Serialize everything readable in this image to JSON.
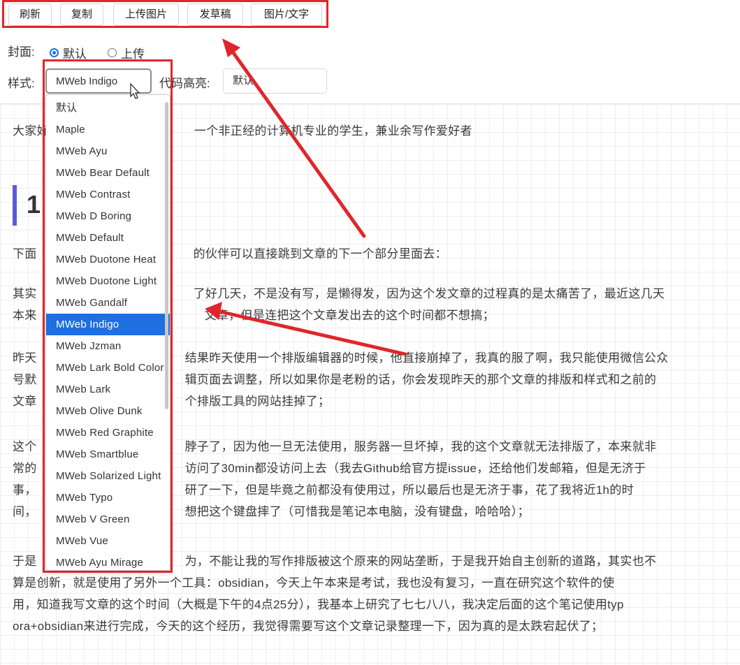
{
  "toolbar": {
    "refresh": "刷新",
    "copy": "复制",
    "upload_image": "上传图片",
    "draft": "发草稿",
    "image_text": "图片/文字"
  },
  "cover": {
    "label": "封面:",
    "default_option": "默认",
    "upload_option": "上传",
    "selected": "默认"
  },
  "style": {
    "label": "样式:",
    "value": "MWeb Indigo",
    "code_label": "代码高亮:",
    "code_value": "默认"
  },
  "dropdown": {
    "items": [
      "默认",
      "Maple",
      "MWeb Ayu",
      "MWeb Bear Default",
      "MWeb Contrast",
      "MWeb D Boring",
      "MWeb Default",
      "MWeb Duotone Heat",
      "MWeb Duotone Light",
      "MWeb Gandalf",
      "MWeb Indigo",
      "MWeb Jzman",
      "MWeb Lark Bold Color",
      "MWeb Lark",
      "MWeb Olive Dunk",
      "MWeb Red Graphite",
      "MWeb Smartblue",
      "MWeb Solarized Light",
      "MWeb Typo",
      "MWeb V Green",
      "MWeb Vue",
      "MWeb Ayu Mirage"
    ],
    "selected": "MWeb Indigo"
  },
  "article": {
    "intro_left": "大家好",
    "intro_right": "一个非正经的计算机专业的学生，兼业余写作爱好者",
    "heading": "1",
    "p1_left": "下面",
    "p1_right": "的伙伴可以直接跳到文章的下一个部分里面去：",
    "p2_l1_left": "其实",
    "p2_l1_right": "了好几天，不是没有写，是懒得发，因为这个发文章的过程真的是太痛苦了，最近这几天",
    "p2_l2_left": "本来",
    "p2_l2_right": "文章，但是连把这个文章发出去的这个时间都不想搞；",
    "p3_l1_left": "昨天",
    "p3_l1_right": "结果昨天使用一个排版编辑器的时候，他直接崩掉了，我真的服了啊，我只能使用微信公众",
    "p3_l2_left": "号默",
    "p3_l2_right": "辑页面去调整，所以如果你是老粉的话，你会发现昨天的那个文章的排版和样式和之前的",
    "p3_l3_left": "文章",
    "p3_l3_right": "个排版工具的网站挂掉了；",
    "p4_l1_left": "这个",
    "p4_l1_right": "脖子了，因为他一旦无法使用，服务器一旦坏掉，我的这个文章就无法排版了，本来就非",
    "p4_l2_left": "常的",
    "p4_l2_right": "访问了30min都没访问上去（我去Github给官方提issue，还给他们发邮箱，但是无济于",
    "p4_l3_left": "事，",
    "p4_l3_right": "研了一下，但是毕竟之前都没有使用过，所以最后也是无济于事，花了我将近1h的时",
    "p4_l4_left": "间，",
    "p4_l4_right": "想把这个键盘摔了（可惜我是笔记本电脑，没有键盘，哈哈哈）；",
    "p5_l1_left": "于是",
    "p5_l1_right": "为，不能让我的写作排版被这个原来的网站垄断，于是我开始自主创新的道路，其实也不",
    "p5_l2": "算是创新，就是使用了另外一个工具：obsidian，今天上午本来是考试，我也没有复习，一直在研究这个软件的使",
    "p5_l3": "用，知道我写文章的这个时间（大概是下午的4点25分），我基本上研究了七七八八，我决定后面的这个笔记使用typ",
    "p5_l4": "ora+obsidian来进行完成，今天的这个经历，我觉得需要写这个文章记录整理一下，因为真的是太跌宕起伏了；"
  },
  "colors": {
    "annotation_red": "#e0262b",
    "selection_blue": "#1e6fe0",
    "heading_accent": "#5b5bd6"
  }
}
